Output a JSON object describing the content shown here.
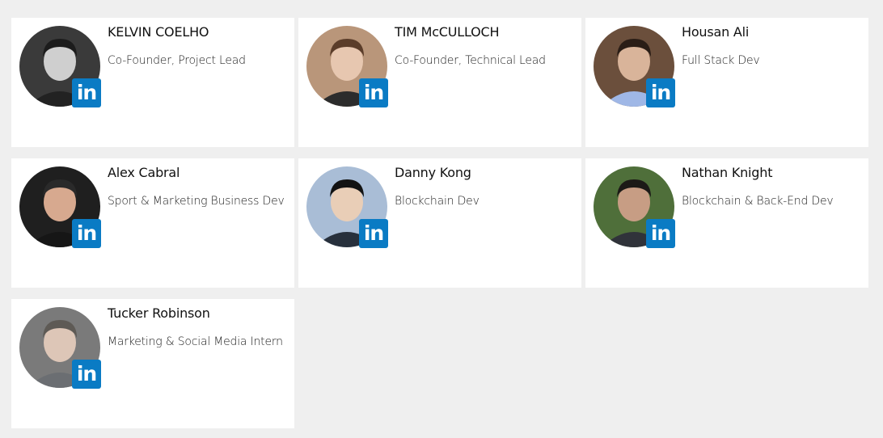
{
  "team": [
    {
      "name": "KELVIN COELHO",
      "role": "Co-Founder, Project Lead",
      "badge": "in",
      "icon": "linkedin-icon",
      "bg": "#3a3a3a",
      "skin": "#cfcfcf",
      "hair": "#1c1c1c",
      "shirt": "#222222"
    },
    {
      "name": "TIM McCULLOCH",
      "role": "Co-Founder, Technical Lead",
      "badge": "in",
      "icon": "linkedin-icon",
      "bg": "#b9967a",
      "skin": "#e7c7b0",
      "hair": "#5b3d2a",
      "shirt": "#2c2c2c"
    },
    {
      "name": "Housan Ali",
      "role": "Full Stack Dev",
      "badge": "in",
      "icon": "linkedin-icon",
      "bg": "#6b4f3c",
      "skin": "#d9b49a",
      "hair": "#2a1d16",
      "shirt": "#9fb7e6"
    },
    {
      "name": "Alex Cabral",
      "role": "Sport & Marketing Business Dev",
      "badge": "in",
      "icon": "linkedin-icon",
      "bg": "#1f1f1f",
      "skin": "#d7a98f",
      "hair": "#2a2a2a",
      "shirt": "#161616"
    },
    {
      "name": "Danny Kong",
      "role": "Blockchain Dev",
      "badge": "in",
      "icon": "linkedin-icon",
      "bg": "#a9bdd6",
      "skin": "#e9ceb7",
      "hair": "#121212",
      "shirt": "#27303c"
    },
    {
      "name": "Nathan Knight",
      "role": "Blockchain & Back-End Dev",
      "badge": "in",
      "icon": "linkedin-icon",
      "bg": "#4f6f3a",
      "skin": "#c79d84",
      "hair": "#1c1a17",
      "shirt": "#30333a"
    },
    {
      "name": "Tucker Robinson",
      "role": "Marketing & Social Media Intern",
      "badge": "in",
      "icon": "linkedin-icon",
      "bg": "#7a7a7a",
      "skin": "#ddc6b7",
      "hair": "#5e5a55",
      "shirt": "#6b6e72"
    }
  ]
}
